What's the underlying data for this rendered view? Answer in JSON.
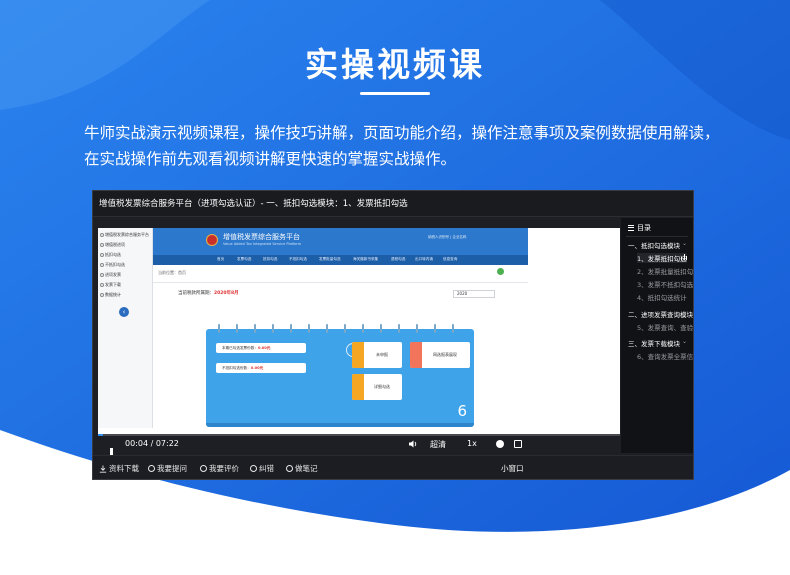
{
  "hero": {
    "title": "实操视频课",
    "intro": "牛师实战演示视频课程，操作技巧讲解，页面功能介绍，操作注意事项及案例数据使用解读，在实战操作前先观看视频讲解更快速的掌握实战操作。"
  },
  "player": {
    "title": "增值税发票综合服务平台（进项勾选认证）- 一、抵扣勾选模块：1、发票抵扣勾选",
    "video": {
      "sidebar_items": [
        "增值税发票综合服务平台",
        "增值税进项",
        "抵扣勾选",
        "不抵扣勾选",
        "进项发票",
        "发票下载",
        "数据统计"
      ],
      "header_title": "增值税发票综合服务平台",
      "header_sub": "Value Added Tax Integrated Service Platform",
      "header_right": "纳税人识别号 | 企业名称",
      "nav_items": [
        "首页",
        "发票勾选",
        "抵扣勾选",
        "不抵扣勾选",
        "发票批量勾选",
        "海关缴款书采集",
        "退税勾选",
        "出口转内销",
        "信息查询"
      ],
      "crumb": "当前位置：首页",
      "period_label": "当前税款所属期：",
      "period_value": "2020年8月",
      "year_value": "2020",
      "row1_label": "本期已勾选发票份数：",
      "row1_value": "0.00元",
      "row2_label": "不抵扣勾选份数：",
      "row2_value": "0.00元",
      "card1": "未申报",
      "card2": "网选报表展现",
      "card3": "详细勾选",
      "page_number": "6"
    },
    "controls": {
      "time": "00:04 / 07:22",
      "progress": 0.009,
      "quality": "超清",
      "speed": "1x"
    },
    "catalog": {
      "heading": "目录",
      "sections": [
        {
          "title": "一、抵扣勾选模块",
          "items": [
            "1、发票抵扣勾选",
            "2、发票批量抵扣勾选",
            "3、发票不抵扣勾选",
            "4、抵扣勾选统计"
          ]
        },
        {
          "title": "二、进项发票查询模块",
          "items": [
            "5、发票查询、查验"
          ]
        },
        {
          "title": "三、发票下载模块",
          "items": [
            "6、查询发票全票信息"
          ]
        }
      ]
    },
    "toolbar": {
      "download": "资料下载",
      "ask": "我要提问",
      "review": "我要评价",
      "error": "纠错",
      "note": "做笔记",
      "mini": "小窗口"
    }
  },
  "colors": {
    "bg_blue": "#1f6fe0",
    "accent": "#2f8df0",
    "video_header": "#2c78cc"
  }
}
